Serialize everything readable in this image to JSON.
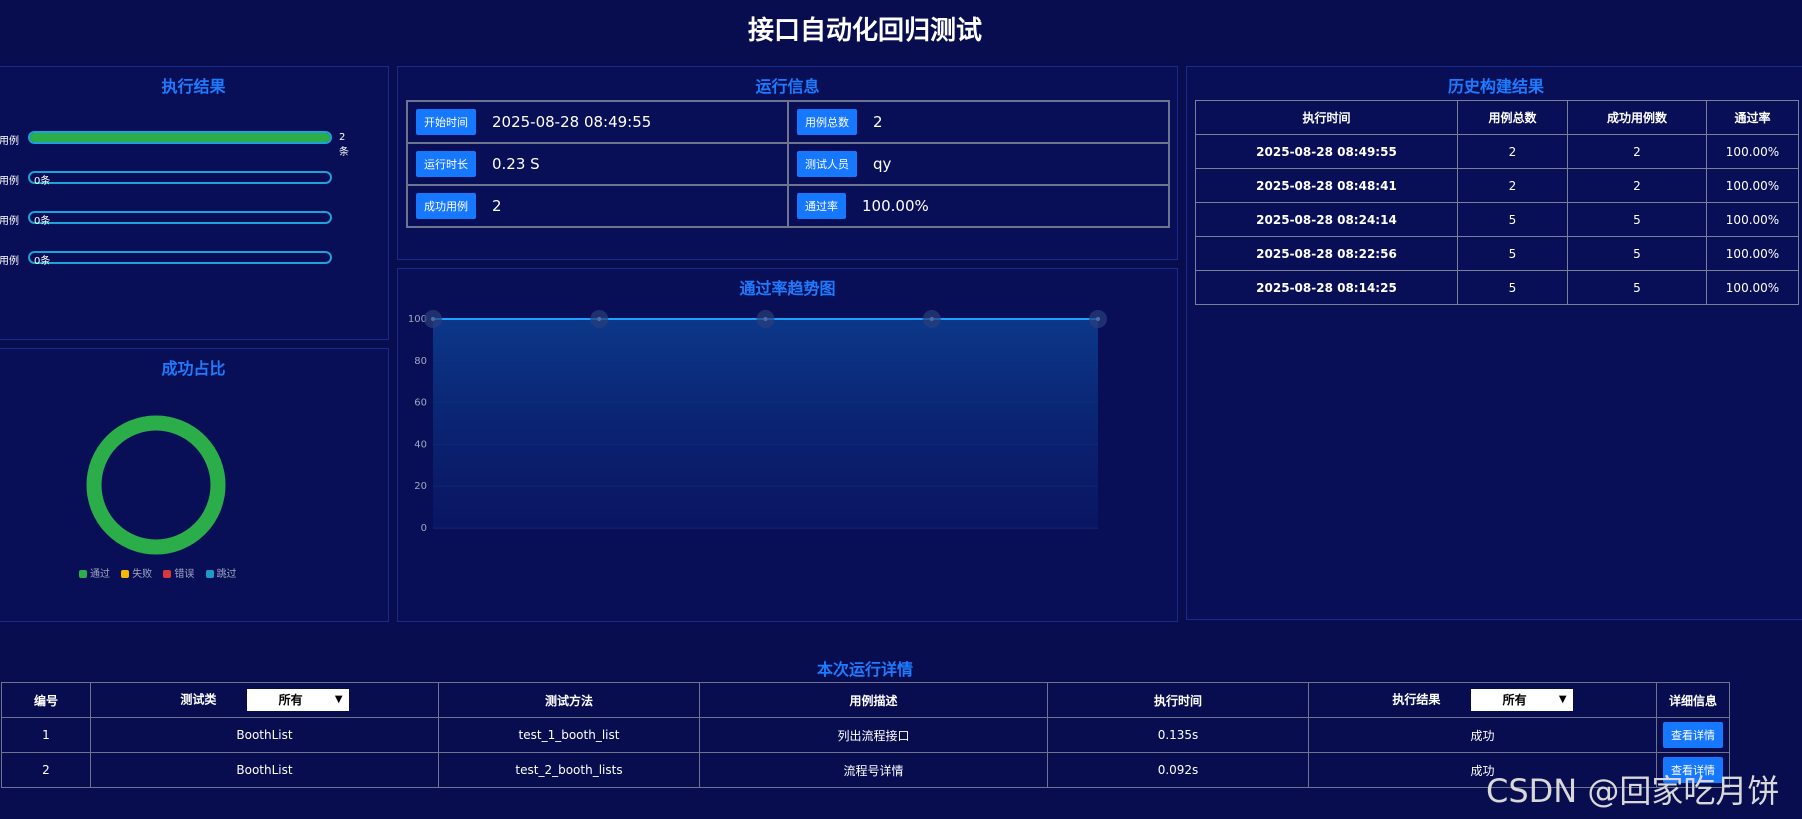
{
  "page": {
    "title": "接口自动化回归测试"
  },
  "colors": {
    "accent": "#1677ff",
    "success": "#2bae4a",
    "title_blue": "#1e7bff",
    "bg": "#070d4f"
  },
  "exec_result": {
    "title": "执行结果",
    "rows": [
      {
        "label": "用例",
        "value_text": "2条",
        "fill": 1.0
      },
      {
        "label": "用例",
        "value_text": "0条",
        "fill": 0.0
      },
      {
        "label": "用例",
        "value_text": "0条",
        "fill": 0.0
      },
      {
        "label": "用例",
        "value_text": "0条",
        "fill": 0.0
      }
    ]
  },
  "success_ratio": {
    "title": "成功占比",
    "legend": [
      {
        "name": "通过",
        "color": "#2bae4a"
      },
      {
        "name": "失败",
        "color": "#f5b800"
      },
      {
        "name": "错误",
        "color": "#d9363e"
      },
      {
        "name": "跳过",
        "color": "#1e9bc7"
      }
    ],
    "passed_fraction": 1.0
  },
  "run_info": {
    "title": "运行信息",
    "items": [
      {
        "label": "开始时间",
        "value": "2025-08-28 08:49:55"
      },
      {
        "label": "用例总数",
        "value": "2"
      },
      {
        "label": "运行时长",
        "value": "0.23 S"
      },
      {
        "label": "测试人员",
        "value": "qy"
      },
      {
        "label": "成功用例",
        "value": "2"
      },
      {
        "label": "通过率",
        "value": "100.00%"
      }
    ]
  },
  "trend": {
    "title": "通过率趋势图"
  },
  "chart_data": {
    "type": "area",
    "title": "通过率趋势图",
    "x": [
      1,
      2,
      3,
      4,
      5
    ],
    "values": [
      100,
      100,
      100,
      100,
      100
    ],
    "ylim": [
      0,
      100
    ],
    "yticks": [
      "0",
      "20",
      "40",
      "60",
      "80",
      "100"
    ],
    "grid": true
  },
  "history": {
    "title": "历史构建结果",
    "headers": [
      "执行时间",
      "用例总数",
      "成功用例数",
      "通过率"
    ],
    "rows": [
      [
        "2025-08-28 08:49:55",
        "2",
        "2",
        "100.00%"
      ],
      [
        "2025-08-28 08:48:41",
        "2",
        "2",
        "100.00%"
      ],
      [
        "2025-08-28 08:24:14",
        "5",
        "5",
        "100.00%"
      ],
      [
        "2025-08-28 08:22:56",
        "5",
        "5",
        "100.00%"
      ],
      [
        "2025-08-28 08:14:25",
        "5",
        "5",
        "100.00%"
      ]
    ]
  },
  "details": {
    "title": "本次运行详情",
    "headers": {
      "id": "编号",
      "cls": "测试类",
      "method": "测试方法",
      "desc": "用例描述",
      "time": "执行时间",
      "result": "执行结果",
      "info": "详细信息"
    },
    "class_filter": "所有",
    "result_filter": "所有",
    "rows": [
      {
        "id": "1",
        "cls": "BoothList",
        "method": "test_1_booth_list",
        "desc": "列出流程接口",
        "time": "0.135s",
        "result": "成功",
        "action": "查看详情"
      },
      {
        "id": "2",
        "cls": "BoothList",
        "method": "test_2_booth_lists",
        "desc": "流程号详情",
        "time": "0.092s",
        "result": "成功",
        "action": "查看详情"
      }
    ]
  },
  "watermark": "CSDN @回家吃月饼"
}
